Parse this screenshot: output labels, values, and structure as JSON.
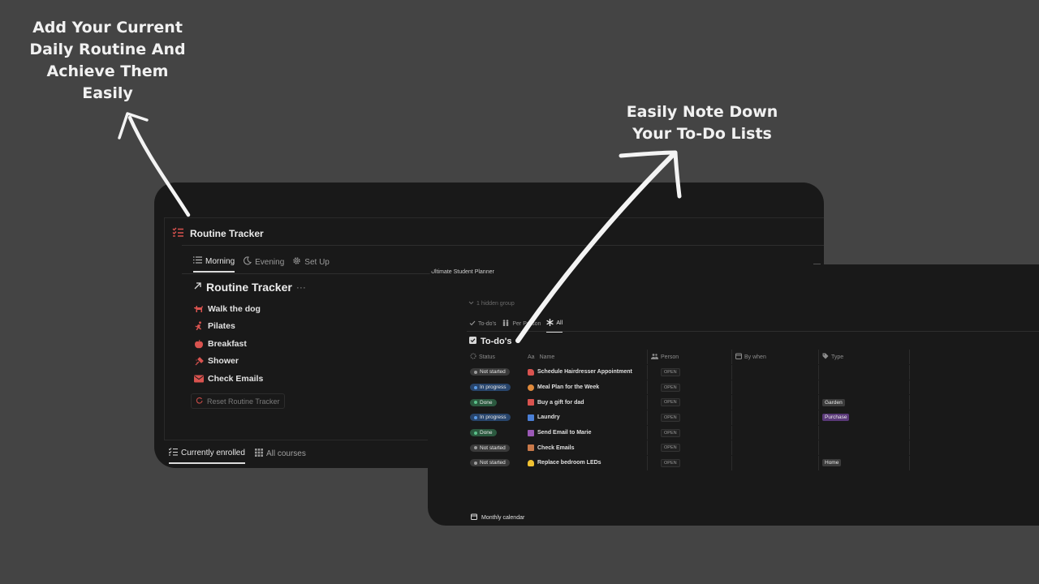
{
  "callouts": {
    "left": [
      "Add Your Current",
      "Daily Routine And",
      "Achieve Them",
      "Easily"
    ],
    "right": [
      "Easily Note Down",
      "Your To-Do Lists"
    ]
  },
  "routine_panel": {
    "title": "Routine Tracker",
    "tabs": [
      {
        "label": "Morning",
        "icon": "list-icon",
        "active": true
      },
      {
        "label": "Evening",
        "icon": "moon-icon",
        "active": false
      },
      {
        "label": "Set Up",
        "icon": "gear-icon",
        "active": false
      }
    ],
    "list_title": "Routine Tracker",
    "list_more": "···",
    "items": [
      {
        "label": "Walk the dog",
        "icon": "dog-icon"
      },
      {
        "label": "Pilates",
        "icon": "running-icon"
      },
      {
        "label": "Breakfast",
        "icon": "apple-icon"
      },
      {
        "label": "Shower",
        "icon": "shower-icon"
      },
      {
        "label": "Check Emails",
        "icon": "mail-icon"
      }
    ],
    "reset_label": "Reset Routine Tracker",
    "bottom_tabs": [
      {
        "label": "Currently enrolled",
        "active": true
      },
      {
        "label": "All courses",
        "active": false
      }
    ]
  },
  "todo_panel": {
    "breadcrumb": "Ultimate Student Planner",
    "hidden_group": "1 hidden group",
    "views": [
      {
        "label": "To-do's",
        "active": false
      },
      {
        "label": "Per Person",
        "active": false
      },
      {
        "label": "All",
        "active": true
      }
    ],
    "title": "To-do's",
    "columns": {
      "status": "Status",
      "name": "Name",
      "person": "Person",
      "by_when": "By when",
      "type": "Type"
    },
    "open_label": "OPEN",
    "rows": [
      {
        "status": "Not started",
        "name": "Schedule Hairdresser Appointment",
        "type": ""
      },
      {
        "status": "In progress",
        "name": "Meal Plan for the Week",
        "type": ""
      },
      {
        "status": "Done",
        "name": "Buy a gift for dad",
        "type": "Garden"
      },
      {
        "status": "In progress",
        "name": "Laundry",
        "type": "Purchase"
      },
      {
        "status": "Done",
        "name": "Send Email to Marie",
        "type": ""
      },
      {
        "status": "Not started",
        "name": "Check Emails",
        "type": ""
      },
      {
        "status": "Not started",
        "name": "Replace bedroom LEDs",
        "type": "Home"
      }
    ],
    "footer": "Monthly calendar"
  },
  "colors": {
    "background": "#444444",
    "panel": "#191919",
    "accent_red": "#d9534f",
    "not_started": "#3a3a3a",
    "in_progress": "#28456c",
    "done": "#2b593f",
    "tag_garden": "#3c3c3c",
    "tag_purchase": "#5a3979",
    "tag_home": "#3c3c3c"
  }
}
